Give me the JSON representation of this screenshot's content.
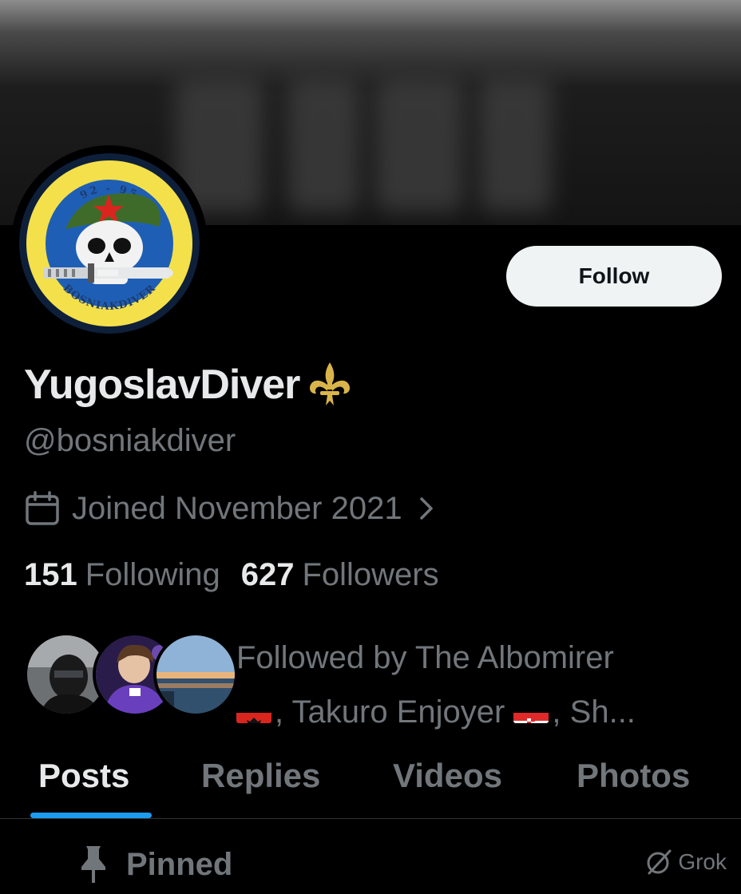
{
  "profile": {
    "display_name": "YugoslavDiver",
    "handle": "@bosniakdiver",
    "joined": "Joined November 2021",
    "following_count": "151",
    "following_label": "Following",
    "followers_count": "627",
    "followers_label": "Followers",
    "badge_icon": "fleur-de-lis-icon"
  },
  "avatar": {
    "top_text": "92 - 95",
    "bottom_text": "BOSNIAKDIVER",
    "colors": {
      "ring": "#f4e04a",
      "field": "#1e5fb5",
      "beret": "#3f6b2a",
      "star": "#d8261f"
    }
  },
  "actions": {
    "follow_label": "Follow"
  },
  "followed_by": {
    "line1": "Followed by The Albomirer",
    "name2_prefix": ", Takuro Enjoyer ",
    "suffix": ", Sh..."
  },
  "tabs": [
    {
      "label": "Posts",
      "active": true
    },
    {
      "label": "Replies",
      "active": false
    },
    {
      "label": "Videos",
      "active": false
    },
    {
      "label": "Photos",
      "active": false
    }
  ],
  "pinned": {
    "label": "Pinned"
  },
  "grok": {
    "label": "Grok"
  },
  "theme": {
    "accent": "#1d9bf0",
    "text": "#e7e9ea",
    "muted": "#71767b",
    "bg": "#000000"
  }
}
